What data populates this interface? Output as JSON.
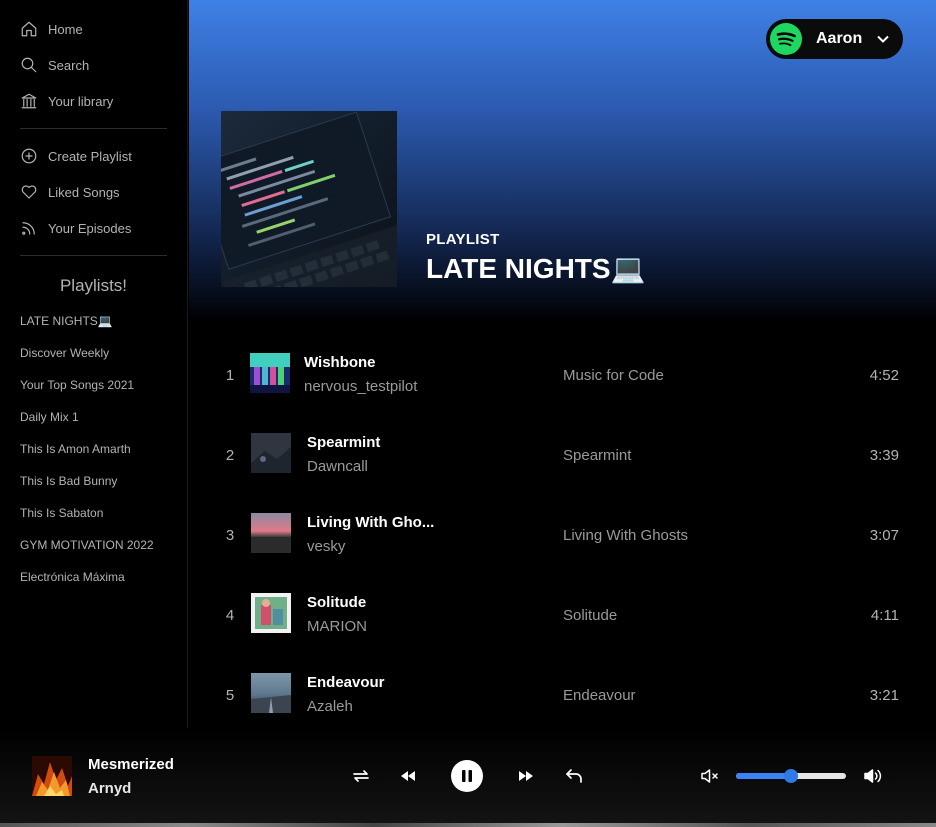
{
  "sidebar": {
    "nav": [
      {
        "label": "Home",
        "icon": "home-icon"
      },
      {
        "label": "Search",
        "icon": "search-icon"
      },
      {
        "label": "Your library",
        "icon": "library-icon"
      }
    ],
    "actions": [
      {
        "label": "Create Playlist",
        "icon": "plus-circle-icon"
      },
      {
        "label": "Liked Songs",
        "icon": "heart-icon"
      },
      {
        "label": "Your Episodes",
        "icon": "rss-icon"
      }
    ],
    "playlists_title": "Playlists!",
    "playlists": [
      "LATE NIGHTS💻",
      "Discover Weekly",
      "Your Top Songs 2021",
      "Daily Mix 1",
      "This Is Amon Amarth",
      "This Is Bad Bunny",
      "This Is Sabaton",
      "GYM MOTIVATION 2022",
      "Electrónica Máxima"
    ]
  },
  "user": {
    "name": "Aaron",
    "logo": "spotify-icon"
  },
  "playlist": {
    "type": "PLAYLIST",
    "title": "LATE NIGHTS💻"
  },
  "tracks": [
    {
      "num": "1",
      "name": "Wishbone",
      "artist": "nervous_testpilot",
      "album": "Music for Code",
      "duration": "4:52"
    },
    {
      "num": "2",
      "name": "Spearmint",
      "artist": "Dawncall",
      "album": "Spearmint",
      "duration": "3:39"
    },
    {
      "num": "3",
      "name": "Living With Gho...",
      "artist": "vesky",
      "album": "Living With Ghosts",
      "duration": "3:07"
    },
    {
      "num": "4",
      "name": "Solitude",
      "artist": "MARION",
      "album": "Solitude",
      "duration": "4:11"
    },
    {
      "num": "5",
      "name": "Endeavour",
      "artist": "Azaleh",
      "album": "Endeavour",
      "duration": "3:21"
    }
  ],
  "player": {
    "title": "Mesmerized",
    "artist": "Arnyd",
    "state": "playing",
    "volume": 0.5,
    "controls": [
      "repeat-icon",
      "previous-icon",
      "pause-icon",
      "next-icon",
      "undo-icon"
    ],
    "volume_icons": [
      "mute-icon",
      "volume-icon"
    ]
  },
  "colors": {
    "accent": "#3f80e6",
    "brand": "#1ed760",
    "volume": "#3b82f6"
  }
}
